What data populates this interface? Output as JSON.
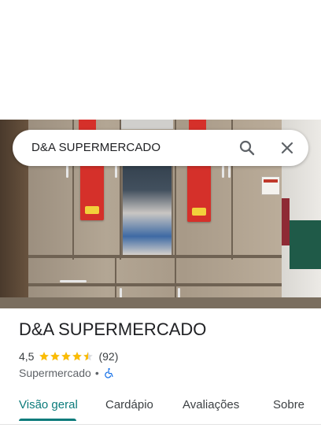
{
  "search": {
    "query": "D&A SUPERMERCADO",
    "search_icon": "search-icon",
    "close_icon": "close-icon"
  },
  "place": {
    "name": "D&A SUPERMERCADO",
    "rating": "4,5",
    "stars_value": 4.5,
    "review_count": "(92)",
    "category": "Supermercado",
    "separator": "•",
    "accessibility_icon": "wheelchair-icon"
  },
  "tabs": [
    {
      "label": "Visão geral",
      "active": true
    },
    {
      "label": "Cardápio",
      "active": false
    },
    {
      "label": "Avaliações",
      "active": false
    },
    {
      "label": "Sobre",
      "active": false
    }
  ],
  "colors": {
    "accent": "#0b7b7b",
    "star": "#fbbc04",
    "accessibility": "#1a73e8"
  }
}
